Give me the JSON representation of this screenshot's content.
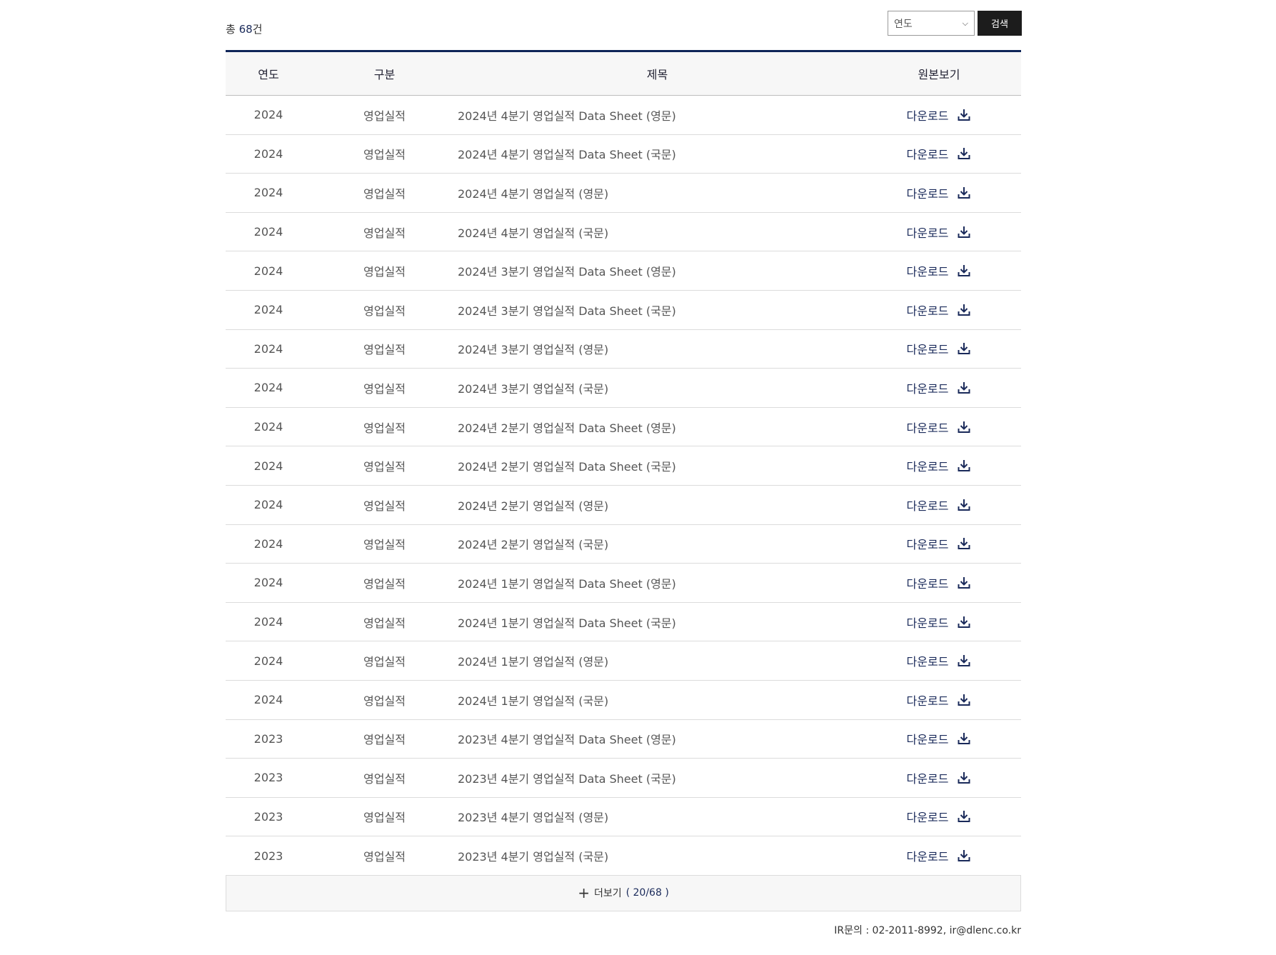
{
  "list": {
    "total_prefix": "총 ",
    "total_count": "68",
    "total_suffix": "건"
  },
  "filter": {
    "year_select_value": "연도",
    "search_button": "검색"
  },
  "table": {
    "headers": {
      "year": "연도",
      "category": "구분",
      "title": "제목",
      "original": "원본보기"
    },
    "download_label": "다운로드",
    "rows": [
      {
        "year": "2024",
        "category": "영업실적",
        "title": "2024년 4분기 영업실적 Data Sheet (영문)"
      },
      {
        "year": "2024",
        "category": "영업실적",
        "title": "2024년 4분기 영업실적 Data Sheet (국문)"
      },
      {
        "year": "2024",
        "category": "영업실적",
        "title": "2024년 4분기 영업실적 (영문)"
      },
      {
        "year": "2024",
        "category": "영업실적",
        "title": "2024년 4분기 영업실적 (국문)"
      },
      {
        "year": "2024",
        "category": "영업실적",
        "title": "2024년 3분기 영업실적 Data Sheet (영문)"
      },
      {
        "year": "2024",
        "category": "영업실적",
        "title": "2024년 3분기 영업실적 Data Sheet (국문)"
      },
      {
        "year": "2024",
        "category": "영업실적",
        "title": "2024년 3분기 영업실적 (영문)"
      },
      {
        "year": "2024",
        "category": "영업실적",
        "title": "2024년 3분기 영업실적 (국문)"
      },
      {
        "year": "2024",
        "category": "영업실적",
        "title": "2024년 2분기 영업실적 Data Sheet (영문)"
      },
      {
        "year": "2024",
        "category": "영업실적",
        "title": "2024년 2분기 영업실적 Data Sheet (국문)"
      },
      {
        "year": "2024",
        "category": "영업실적",
        "title": "2024년 2분기 영업실적 (영문)"
      },
      {
        "year": "2024",
        "category": "영업실적",
        "title": "2024년 2분기 영업실적 (국문)"
      },
      {
        "year": "2024",
        "category": "영업실적",
        "title": "2024년 1분기 영업실적 Data Sheet (영문)"
      },
      {
        "year": "2024",
        "category": "영업실적",
        "title": "2024년 1분기 영업실적 Data Sheet (국문)"
      },
      {
        "year": "2024",
        "category": "영업실적",
        "title": "2024년 1분기 영업실적 (영문)"
      },
      {
        "year": "2024",
        "category": "영업실적",
        "title": "2024년 1분기 영업실적 (국문)"
      },
      {
        "year": "2023",
        "category": "영업실적",
        "title": "2023년 4분기 영업실적 Data Sheet (영문)"
      },
      {
        "year": "2023",
        "category": "영업실적",
        "title": "2023년 4분기 영업실적 Data Sheet (국문)"
      },
      {
        "year": "2023",
        "category": "영업실적",
        "title": "2023년 4분기 영업실적 (영문)"
      },
      {
        "year": "2023",
        "category": "영업실적",
        "title": "2023년 4분기 영업실적 (국문)"
      }
    ]
  },
  "more": {
    "label": "더보기",
    "count_text": "( 20/68 )"
  },
  "footer": {
    "contact": "IR문의 : 02-2011-8992, ir@dlenc.co.kr"
  }
}
